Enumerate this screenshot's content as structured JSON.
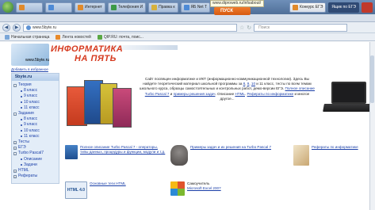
{
  "taskbar": {
    "items": [
      "",
      "",
      "Интернет",
      "Телефония И",
      "Правка к",
      "ЯБ Net Т",
      "Конкурс ЕГЭ",
      ""
    ],
    "search_popup": "ПУСК",
    "url_popup": "www.diproweb.ru/infsabout/",
    "tray_text": "Ящик по ЕГЭ"
  },
  "browser": {
    "url": "www.5byte.ru",
    "search_placeholder": "Поиск",
    "bookmarks": [
      "Начальная страница",
      "Лента новостей",
      "QIP.RU: почта, поис..."
    ]
  },
  "site": {
    "logo_line1": "ИНФОРМАТИКА",
    "logo_line2": "НА ПЯТЬ",
    "logo_url": "www.5byte.ru",
    "fav_link": "Добавить в избранное",
    "sidebar_title": "5byte.ru",
    "sidebar": [
      {
        "label": "Теория",
        "sub": [
          "8 класс",
          "9 класс",
          "10 класс",
          "11 класс"
        ]
      },
      {
        "label": "Задания",
        "sub": [
          "8 класс",
          "9 класс",
          "10 класс",
          "11 класс"
        ]
      },
      {
        "label": "Тесты",
        "sub": []
      },
      {
        "label": "ЕГЭ",
        "sub": []
      },
      {
        "label": "Turbo Pascal7",
        "sub": [
          "Описание",
          "Задачи"
        ]
      },
      {
        "label": "HTML",
        "sub": []
      },
      {
        "label": "Рефераты",
        "sub": []
      }
    ],
    "intro_text_1": "Сайт посвящен информатике и ИКТ (информационно-коммуникационной технологии). Здесь Вы найдете теоретический материал школьной программы за ",
    "intro_classes": [
      "8",
      "9",
      "10"
    ],
    "intro_text_2": " и 11 класс, тесты по всем темам школьного курса, образцы самостоятельных и контрольных работ, демо-версии ЕГЭ. ",
    "intro_link_1": "Полное описание Turbo Pascal 7",
    "intro_text_3": " и ",
    "intro_link_2": "примеры решения задач",
    "intro_text_4": ". Описание ",
    "intro_link_3": "HTML",
    "intro_text_5": ". ",
    "intro_link_4": "Рефераты по информатике",
    "intro_text_6": " и многое другое...",
    "features": [
      {
        "caption": "Полное описание Turbo Pascal 7 - операторы, типы данных, процедуры и функции, модули и т.д."
      },
      {
        "caption": "Примеры задач и их решения на Turbo Pascal 7"
      },
      {
        "caption": "Рефераты по информатике"
      },
      {
        "caption": "Основные теги HTML",
        "thumb_text": "HTML 4.0"
      },
      {
        "caption_plain": "Самоучитель",
        "caption": "Microsoft Excel 2007"
      }
    ]
  },
  "colors": {
    "link": "#1a3fa8",
    "logo": "#d63a1f",
    "sidebar_bg": "#e3edf8"
  }
}
